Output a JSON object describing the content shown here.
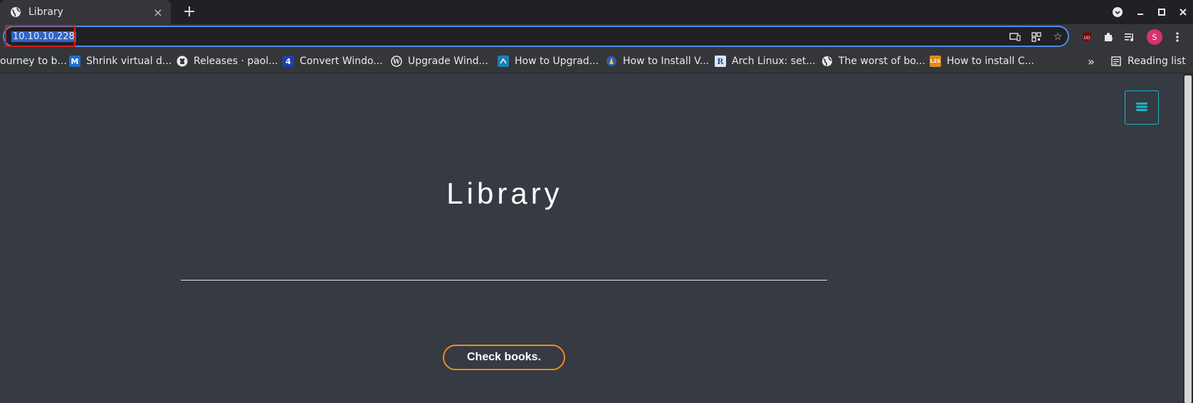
{
  "browser": {
    "tab": {
      "title": "Library",
      "close": "×"
    },
    "new_tab": "+",
    "window_controls": {
      "minimize": "–",
      "maximize": "□",
      "close": "×"
    },
    "address": "10.10.10.228",
    "profile_initial": "S",
    "ublock_badge": "UD"
  },
  "bookmarks": {
    "items": [
      {
        "label": "ourney to b...",
        "icon": ""
      },
      {
        "label": "Shrink virtual d...",
        "icon": "M"
      },
      {
        "label": "Releases · paol...",
        "icon": "github"
      },
      {
        "label": "Convert Windo...",
        "icon": "4"
      },
      {
        "label": "Upgrade Wind...",
        "icon": "wordpress"
      },
      {
        "label": "How to Upgrad...",
        "icon": "tech"
      },
      {
        "label": "How to Install V...",
        "icon": "linux"
      },
      {
        "label": "Arch Linux: set...",
        "icon": "R"
      },
      {
        "label": "The worst of bo...",
        "icon": "globe"
      },
      {
        "label": "How to install C...",
        "icon": "L2S"
      }
    ],
    "overflow": "»",
    "reading_list": "Reading list"
  },
  "page": {
    "title": "Library",
    "button": "Check books."
  },
  "colors": {
    "accent_cyan": "#1fb3c4",
    "button_border": "#f28a1d",
    "highlight_box": "#d21f1f"
  }
}
